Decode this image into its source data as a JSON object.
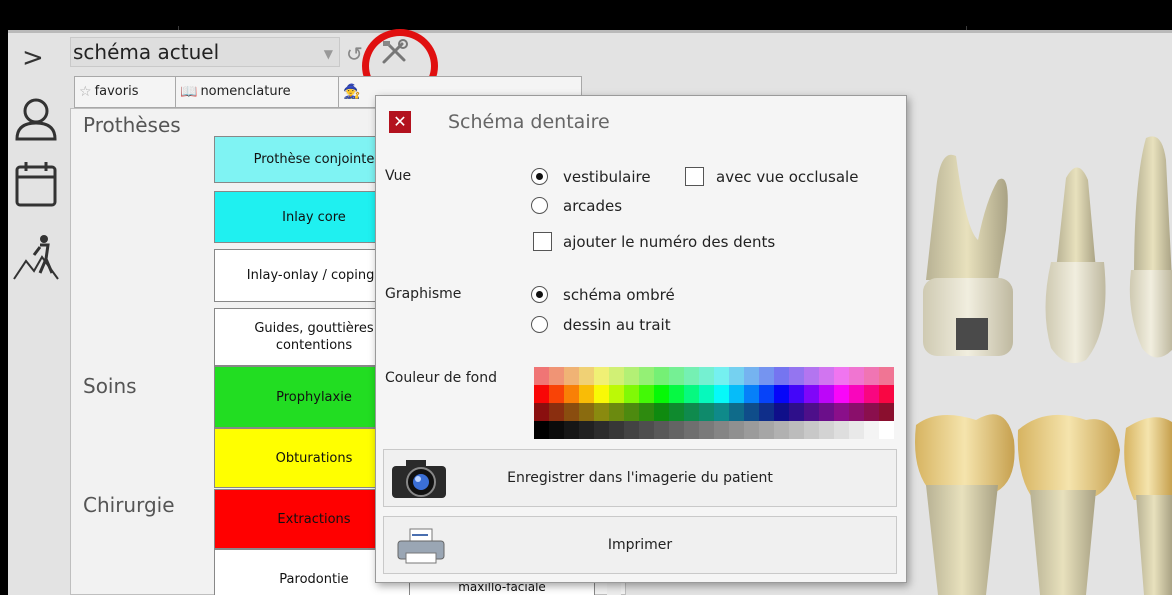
{
  "toolbar": {
    "combo_value": "schéma actuel",
    "combo_arrow_icon": "chevron-down-icon",
    "undo_icon": "undo-icon",
    "tools_icon": "tools-icon",
    "highlight_color": "#e01010"
  },
  "rail": {
    "expand_icon": "chevron-right-icon",
    "icons": [
      "person-icon",
      "calendar-icon",
      "hiking-icon"
    ]
  },
  "tabs": [
    {
      "label": "favoris",
      "icon": "star-icon"
    },
    {
      "label": "nomenclature",
      "icon": "book-icon"
    },
    {
      "label": "",
      "icon": "wizard-hat-icon"
    }
  ],
  "categories": [
    {
      "name": "Prothèses"
    },
    {
      "name": "Soins"
    },
    {
      "name": "Chirurgie"
    }
  ],
  "items": [
    {
      "label": "Prothèse conjointe",
      "color": "#7ff3f3"
    },
    {
      "label": "Inlay core",
      "color": "#1ff0f0"
    },
    {
      "label": "Inlay-onlay / copings",
      "color": "#ffffff"
    },
    {
      "label": "Guides, gouttières contentions",
      "color": "#ffffff"
    },
    {
      "label": "Prophylaxie",
      "color": "#22dd22"
    },
    {
      "label": "Obturations",
      "color": "#ffff00"
    },
    {
      "label": "Extractions",
      "color": "#ff0000"
    },
    {
      "label": "Parodontie",
      "color": "#ffffff"
    }
  ],
  "hidden_item": {
    "label": "maxillo-faciale"
  },
  "dialog": {
    "close_label": "✕",
    "title": "Schéma dentaire",
    "vue_label": "Vue",
    "vue_options": [
      "vestibulaire",
      "arcades"
    ],
    "vue_selected": "vestibulaire",
    "occlusal_label": "avec vue occlusale",
    "occlusal_checked": false,
    "numero_label": "ajouter le numéro des dents",
    "numero_checked": false,
    "graphisme_label": "Graphisme",
    "graphisme_options": [
      "schéma ombré",
      "dessin au trait"
    ],
    "graphisme_selected": "schéma ombré",
    "couleur_label": "Couleur de fond",
    "save_button": "Enregistrer dans l'imagerie du patient",
    "save_icon": "camera-icon",
    "print_button": "Imprimer",
    "print_icon": "printer-icon"
  },
  "annotation": {
    "arrow_color": "#d40000"
  }
}
